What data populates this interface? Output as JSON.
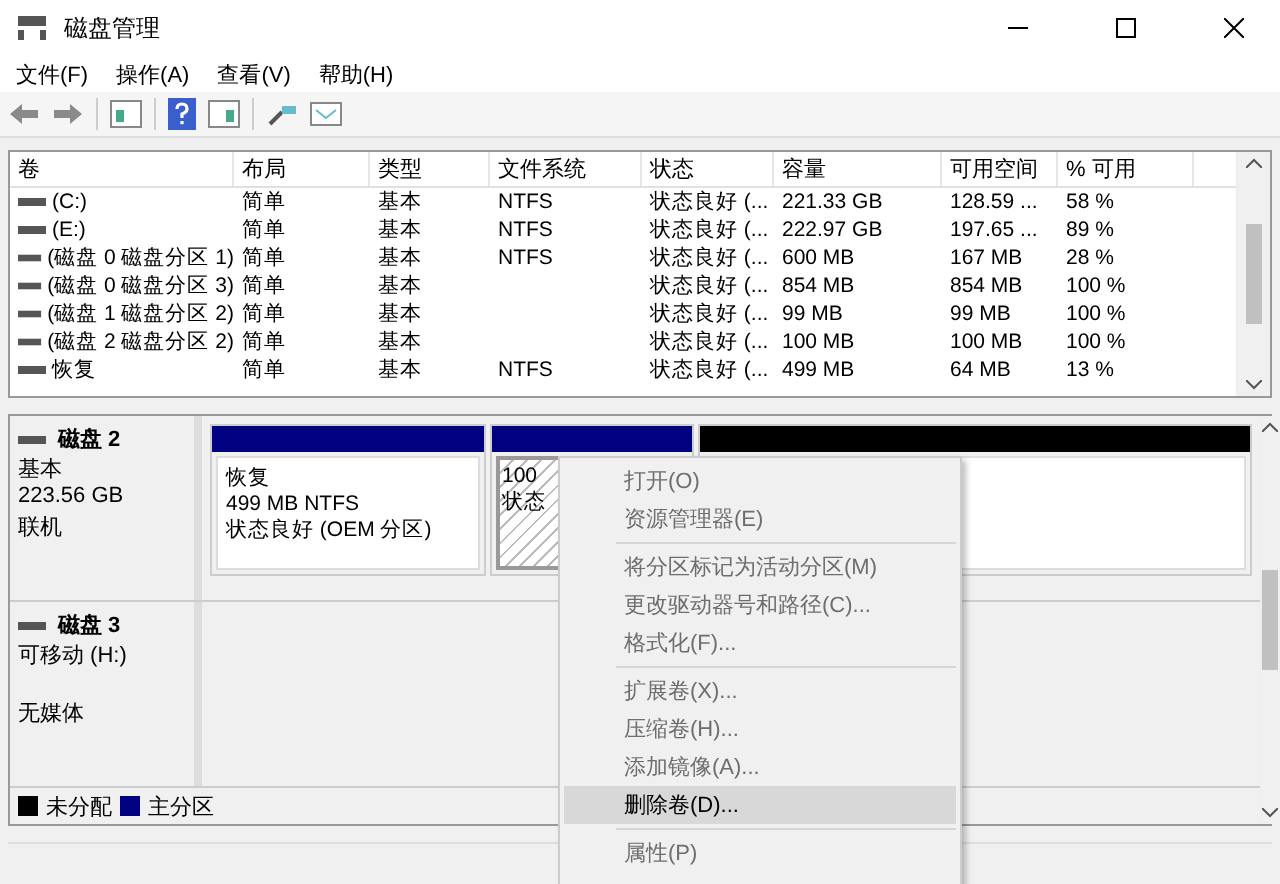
{
  "window": {
    "title": "磁盘管理"
  },
  "menu": [
    "文件(F)",
    "操作(A)",
    "查看(V)",
    "帮助(H)"
  ],
  "table": {
    "columns": [
      "卷",
      "布局",
      "类型",
      "文件系统",
      "状态",
      "容量",
      "可用空间",
      "% 可用"
    ],
    "rows": [
      [
        "(C:)",
        "简单",
        "基本",
        "NTFS",
        "状态良好 (...",
        "221.33 GB",
        "128.59 ...",
        "58 %"
      ],
      [
        "(E:)",
        "简单",
        "基本",
        "NTFS",
        "状态良好 (...",
        "222.97 GB",
        "197.65 ...",
        "89 %"
      ],
      [
        "(磁盘 0 磁盘分区 1)",
        "简单",
        "基本",
        "NTFS",
        "状态良好 (...",
        "600 MB",
        "167 MB",
        "28 %"
      ],
      [
        "(磁盘 0 磁盘分区 3)",
        "简单",
        "基本",
        "",
        "状态良好 (...",
        "854 MB",
        "854 MB",
        "100 %"
      ],
      [
        "(磁盘 1 磁盘分区 2)",
        "简单",
        "基本",
        "",
        "状态良好 (...",
        "99 MB",
        "99 MB",
        "100 %"
      ],
      [
        "(磁盘 2 磁盘分区 2)",
        "简单",
        "基本",
        "",
        "状态良好 (...",
        "100 MB",
        "100 MB",
        "100 %"
      ],
      [
        "恢复",
        "简单",
        "基本",
        "NTFS",
        "状态良好 (...",
        "499 MB",
        "64 MB",
        "13 %"
      ]
    ]
  },
  "disks": [
    {
      "name": "磁盘 2",
      "type": "基本",
      "size": "223.56 GB",
      "status": "联机",
      "partitions": [
        {
          "kind": "primary",
          "selected": false,
          "lines": [
            "恢复",
            "499 MB NTFS",
            "状态良好 (OEM 分区)"
          ]
        },
        {
          "kind": "primary",
          "selected": true,
          "lines": [
            "100",
            "状态"
          ]
        },
        {
          "kind": "unallocated",
          "selected": false
        }
      ]
    },
    {
      "name": "磁盘 3",
      "type": "可移动 (H:)",
      "status": "无媒体"
    }
  ],
  "legend": [
    {
      "label": "未分配",
      "color": "#000000"
    },
    {
      "label": "主分区",
      "color": "#000080"
    }
  ],
  "context_menu": {
    "groups": [
      [
        {
          "label": "打开(O)",
          "disabled": true,
          "selected": false
        },
        {
          "label": "资源管理器(E)",
          "disabled": true,
          "selected": false
        }
      ],
      [
        {
          "label": "将分区标记为活动分区(M)",
          "disabled": true,
          "selected": false
        },
        {
          "label": "更改驱动器号和路径(C)...",
          "disabled": true,
          "selected": false
        },
        {
          "label": "格式化(F)...",
          "disabled": true,
          "selected": false
        }
      ],
      [
        {
          "label": "扩展卷(X)...",
          "disabled": true,
          "selected": false
        },
        {
          "label": "压缩卷(H)...",
          "disabled": true,
          "selected": false
        },
        {
          "label": "添加镜像(A)...",
          "disabled": true,
          "selected": false
        },
        {
          "label": "删除卷(D)...",
          "disabled": false,
          "selected": true
        }
      ],
      [
        {
          "label": "属性(P)",
          "disabled": true,
          "selected": false
        }
      ]
    ]
  }
}
